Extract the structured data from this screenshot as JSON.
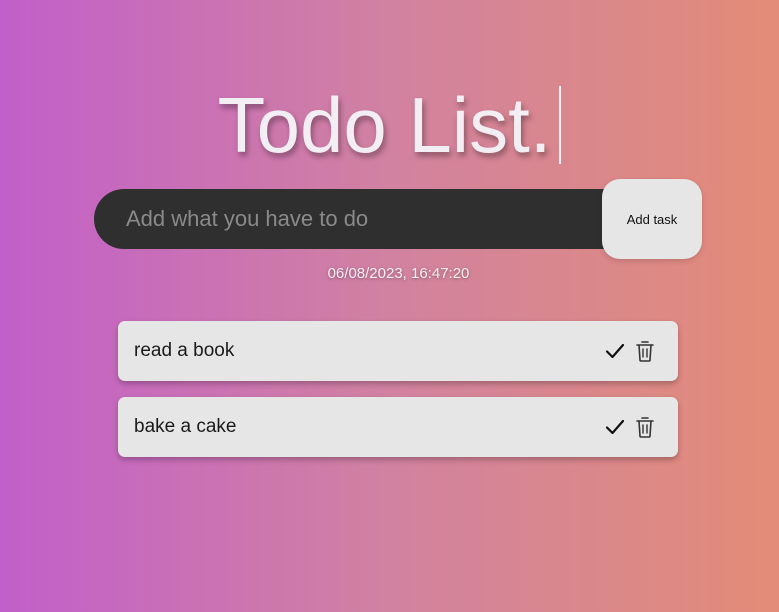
{
  "header": {
    "title": "Todo List."
  },
  "form": {
    "placeholder": "Add what you have to do",
    "value": "",
    "add_label": "Add task"
  },
  "timestamp": "06/08/2023, 16:47:20",
  "todos": [
    {
      "text": "read a book",
      "icons": [
        "check-icon",
        "trash-icon"
      ]
    },
    {
      "text": "bake a cake",
      "icons": [
        "check-icon",
        "trash-icon"
      ]
    }
  ],
  "colors": {
    "gradient_start": "#c25fca",
    "gradient_mid": "#d182a0",
    "gradient_end": "#e38c78",
    "input_bg": "#2f2f2f",
    "card_bg": "#e6e6e6"
  }
}
